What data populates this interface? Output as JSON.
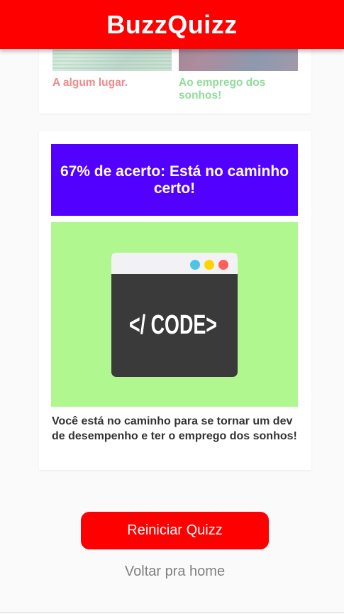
{
  "header": {
    "title": "BuzzQuizz"
  },
  "previous_question": {
    "answers": [
      {
        "label": "A algum lugar.",
        "color": "#f08a8a"
      },
      {
        "label": "Ao emprego dos sonhos!",
        "color": "#8fdc9a"
      }
    ]
  },
  "result": {
    "title": "67% de acerto: Está no caminho certo!",
    "title_bg": "#5200ff",
    "image": {
      "text": "</ CODE>",
      "bg": "#b0f78f",
      "dots": [
        "#4fc3e8",
        "#ffd500",
        "#ff5f57"
      ]
    },
    "description": "Você está no caminho para se tornar um dev de desempenho e ter o emprego dos sonhos!"
  },
  "actions": {
    "restart_label": "Reiniciar Quizz",
    "home_label": "Voltar pra home"
  },
  "colors": {
    "accent": "#ff0000",
    "background": "#fafafa"
  }
}
